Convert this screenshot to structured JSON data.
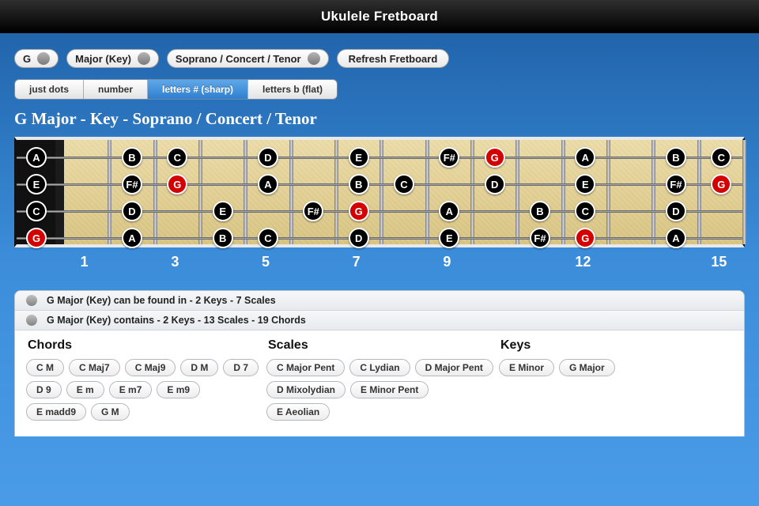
{
  "title": "Ukulele Fretboard",
  "toolbar": {
    "root": "G",
    "quality": "Major (Key)",
    "tuning": "Soprano / Concert / Tenor",
    "refresh": "Refresh Fretboard"
  },
  "view_modes": {
    "options": [
      "just dots",
      "number",
      "letters # (sharp)",
      "letters b (flat)"
    ],
    "active_index": 2
  },
  "heading": "G Major - Key - Soprano / Concert / Tenor",
  "fretboard": {
    "frets": 15,
    "markers": [
      1,
      3,
      5,
      7,
      9,
      12,
      15
    ],
    "strings": [
      {
        "open": "A",
        "notes": [
          {
            "f": 2,
            "n": "B"
          },
          {
            "f": 3,
            "n": "C"
          },
          {
            "f": 5,
            "n": "D"
          },
          {
            "f": 7,
            "n": "E"
          },
          {
            "f": 9,
            "n": "F#"
          },
          {
            "f": 10,
            "n": "G",
            "root": true
          },
          {
            "f": 12,
            "n": "A"
          },
          {
            "f": 14,
            "n": "B"
          },
          {
            "f": 15,
            "n": "C"
          }
        ]
      },
      {
        "open": "E",
        "notes": [
          {
            "f": 2,
            "n": "F#"
          },
          {
            "f": 3,
            "n": "G",
            "root": true
          },
          {
            "f": 5,
            "n": "A"
          },
          {
            "f": 7,
            "n": "B"
          },
          {
            "f": 8,
            "n": "C"
          },
          {
            "f": 10,
            "n": "D"
          },
          {
            "f": 12,
            "n": "E"
          },
          {
            "f": 14,
            "n": "F#"
          },
          {
            "f": 15,
            "n": "G",
            "root": true
          }
        ]
      },
      {
        "open": "C",
        "notes": [
          {
            "f": 2,
            "n": "D"
          },
          {
            "f": 4,
            "n": "E"
          },
          {
            "f": 6,
            "n": "F#"
          },
          {
            "f": 7,
            "n": "G",
            "root": true
          },
          {
            "f": 9,
            "n": "A"
          },
          {
            "f": 11,
            "n": "B"
          },
          {
            "f": 12,
            "n": "C"
          },
          {
            "f": 14,
            "n": "D"
          }
        ]
      },
      {
        "open": "G",
        "open_root": true,
        "notes": [
          {
            "f": 2,
            "n": "A"
          },
          {
            "f": 4,
            "n": "B"
          },
          {
            "f": 5,
            "n": "C"
          },
          {
            "f": 7,
            "n": "D"
          },
          {
            "f": 9,
            "n": "E"
          },
          {
            "f": 11,
            "n": "F#"
          },
          {
            "f": 12,
            "n": "G",
            "root": true
          },
          {
            "f": 14,
            "n": "A"
          }
        ]
      }
    ]
  },
  "relations": {
    "found_in": "G Major (Key) can be found in - 2 Keys - 7 Scales",
    "contains": "G Major (Key) contains - 2 Keys - 13 Scales - 19 Chords"
  },
  "lists": {
    "chords_title": "Chords",
    "scales_title": "Scales",
    "keys_title": "Keys",
    "chords": [
      "C M",
      "C Maj7",
      "C Maj9",
      "D M",
      "D 7",
      "D 9",
      "E m",
      "E m7",
      "E m9",
      "E madd9",
      "G M"
    ],
    "scales": [
      "C Major Pent",
      "C Lydian",
      "D Major Pent",
      "D Mixolydian",
      "E Minor Pent",
      "E Aeolian"
    ],
    "keys": [
      "E Minor",
      "G Major"
    ]
  }
}
